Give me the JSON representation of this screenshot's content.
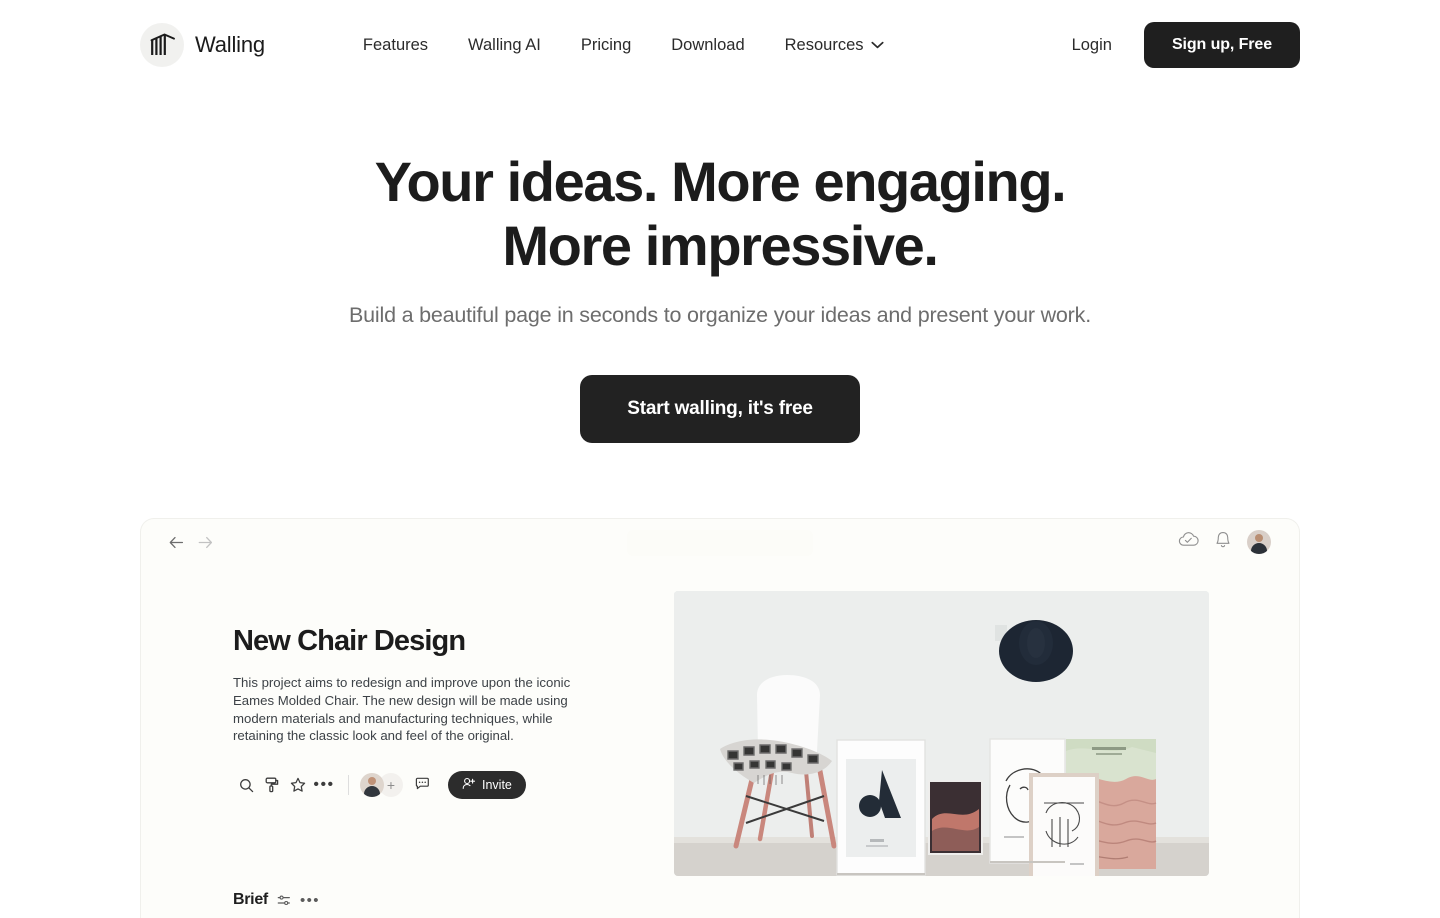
{
  "brand": {
    "name": "Walling",
    "logo_icon": "wall-logo-icon"
  },
  "nav": {
    "items": [
      {
        "label": "Features",
        "icon": null
      },
      {
        "label": "Walling AI",
        "icon": null
      },
      {
        "label": "Pricing",
        "icon": null
      },
      {
        "label": "Download",
        "icon": null
      },
      {
        "label": "Resources",
        "icon": "chevron-down-icon"
      }
    ],
    "login_label": "Login",
    "signup_label": "Sign up, Free"
  },
  "hero": {
    "title_line1": "Your ideas. More engaging.",
    "title_line2": "More impressive.",
    "subtitle": "Build a beautiful page in seconds to organize your ideas and present your work.",
    "cta_label": "Start walling, it's free"
  },
  "preview": {
    "topbar": {
      "back_icon": "arrow-left-icon",
      "forward_icon": "arrow-right-icon",
      "search_placeholder": "",
      "cloud_icon": "cloud-check-icon",
      "bell_icon": "bell-icon",
      "avatar": "user-avatar"
    },
    "document": {
      "title": "New Chair Design",
      "description": "This project aims to redesign and improve upon the iconic Eames Molded Chair. The new design will be made using modern materials and manufacturing techniques, while retaining the classic look and feel of the original.",
      "toolbar": {
        "search_icon": "search-icon",
        "theme_icon": "paint-roller-icon",
        "star_icon": "star-icon",
        "more_icon": "more-horizontal-icon",
        "member_avatar": "member-avatar",
        "add_member_icon": "plus-icon",
        "comment_icon": "comment-icon",
        "invite_label": "Invite",
        "invite_icon": "user-plus-icon"
      },
      "brief": {
        "label": "Brief",
        "settings_icon": "sliders-icon",
        "more_icon": "more-horizontal-icon"
      }
    },
    "photo": {
      "alt": "White Eames molded chair with framed artwork leaning against a wall and a navy hat hanging"
    }
  },
  "colors": {
    "ink": "#1c1c1c",
    "muted": "#6d6d6d",
    "button_dark": "#222222",
    "preview_bg": "#fdfdfa"
  }
}
